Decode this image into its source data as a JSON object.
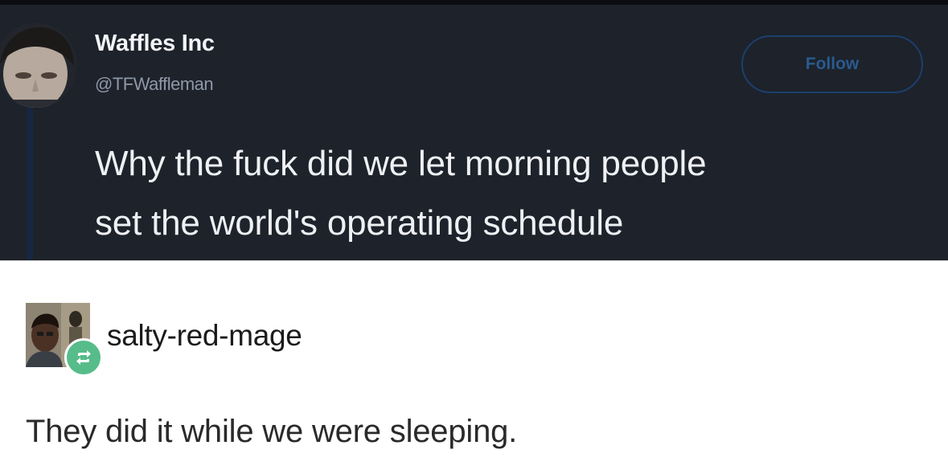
{
  "tweet": {
    "display_name": "Waffles Inc",
    "handle": "@TFWaffleman",
    "follow_label": "Follow",
    "text_lines": [
      "Why the fuck did we let morning people",
      "set the world's operating schedule"
    ]
  },
  "reblog": {
    "username": "salty-red-mage",
    "text": "They did it while we were sleeping."
  },
  "colors": {
    "tweet_bg": "#1d222b",
    "follow_accent": "#1d3f6b",
    "reblog_badge": "#56bc8a"
  }
}
